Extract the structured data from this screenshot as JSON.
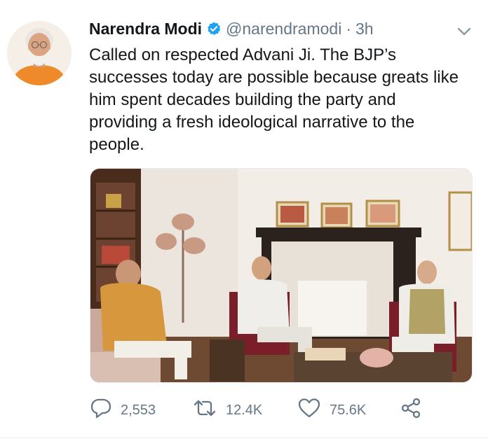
{
  "tweet": {
    "author_name": "Narendra Modi",
    "handle": "@narendramodi",
    "separator": "·",
    "time": "3h",
    "text": "Called on respected Advani Ji. The BJP’s successes today are possible because greats like him spent decades building the party and providing a fresh ideological narrative to the people.",
    "verified": true
  },
  "actions": {
    "replies": "2,553",
    "retweets": "12.4K",
    "likes": "75.6K"
  },
  "icons": {
    "verified": "verified-badge-icon",
    "caret": "chevron-down-icon",
    "reply": "comment-icon",
    "retweet": "retweet-icon",
    "like": "heart-icon",
    "share": "share-icon"
  },
  "colors": {
    "verified_blue": "#1da1f2",
    "muted_gray": "#657786",
    "text": "#14171a"
  }
}
